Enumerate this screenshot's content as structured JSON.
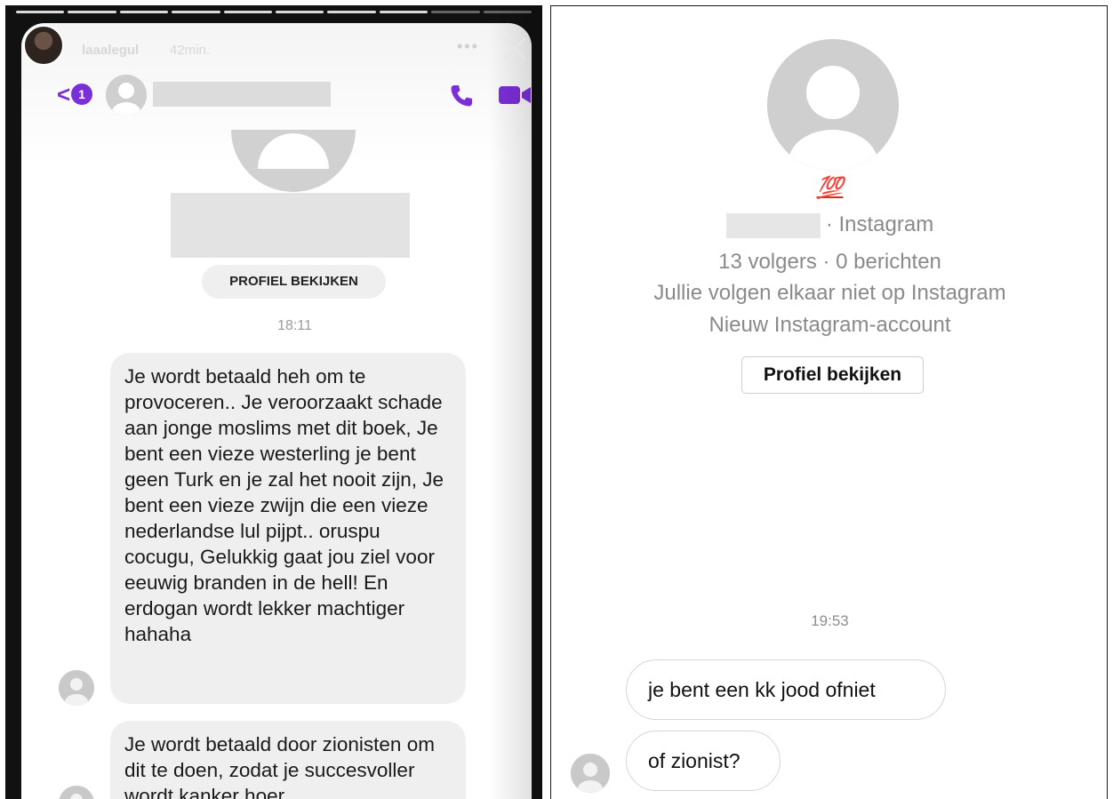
{
  "left": {
    "story": {
      "username": "laaalegul",
      "time_ago": "42min.",
      "more_icon": "three-dots-icon",
      "close_icon": "close-icon"
    },
    "chat_header": {
      "back_icon": "chevron-left-icon",
      "unread_badge": "1",
      "call_icon": "phone-icon",
      "video_icon": "video-camera-icon",
      "accent_color": "#7b2fd8"
    },
    "profile_button": "PROFIEL BEKIJKEN",
    "timestamp": "18:11",
    "messages": [
      "Je wordt betaald heh om te provoceren.. Je veroorzaakt schade aan jonge moslims met dit boek, Je bent een vieze westerling je bent geen Turk en je zal het nooit zijn, Je bent een vieze zwijn die een vieze nederlandse lul pijpt.. oruspu cocugu, Gelukkig gaat jou ziel voor eeuwig branden in de hell! En erdogan wordt lekker machtiger hahaha",
      "Je wordt betaald door zionisten om dit te doen, zodat je succesvoller wordt kanker hoer"
    ]
  },
  "right": {
    "emoji": "💯",
    "handle_suffix": "· Instagram",
    "stats": "13 volgers · 0 berichten",
    "follow_status": "Jullie volgen elkaar niet op Instagram",
    "account_note": "Nieuw Instagram-account",
    "profile_button": "Profiel bekijken",
    "timestamp": "19:53",
    "messages": [
      "je bent een kk jood ofniet",
      "of zionist?"
    ]
  }
}
